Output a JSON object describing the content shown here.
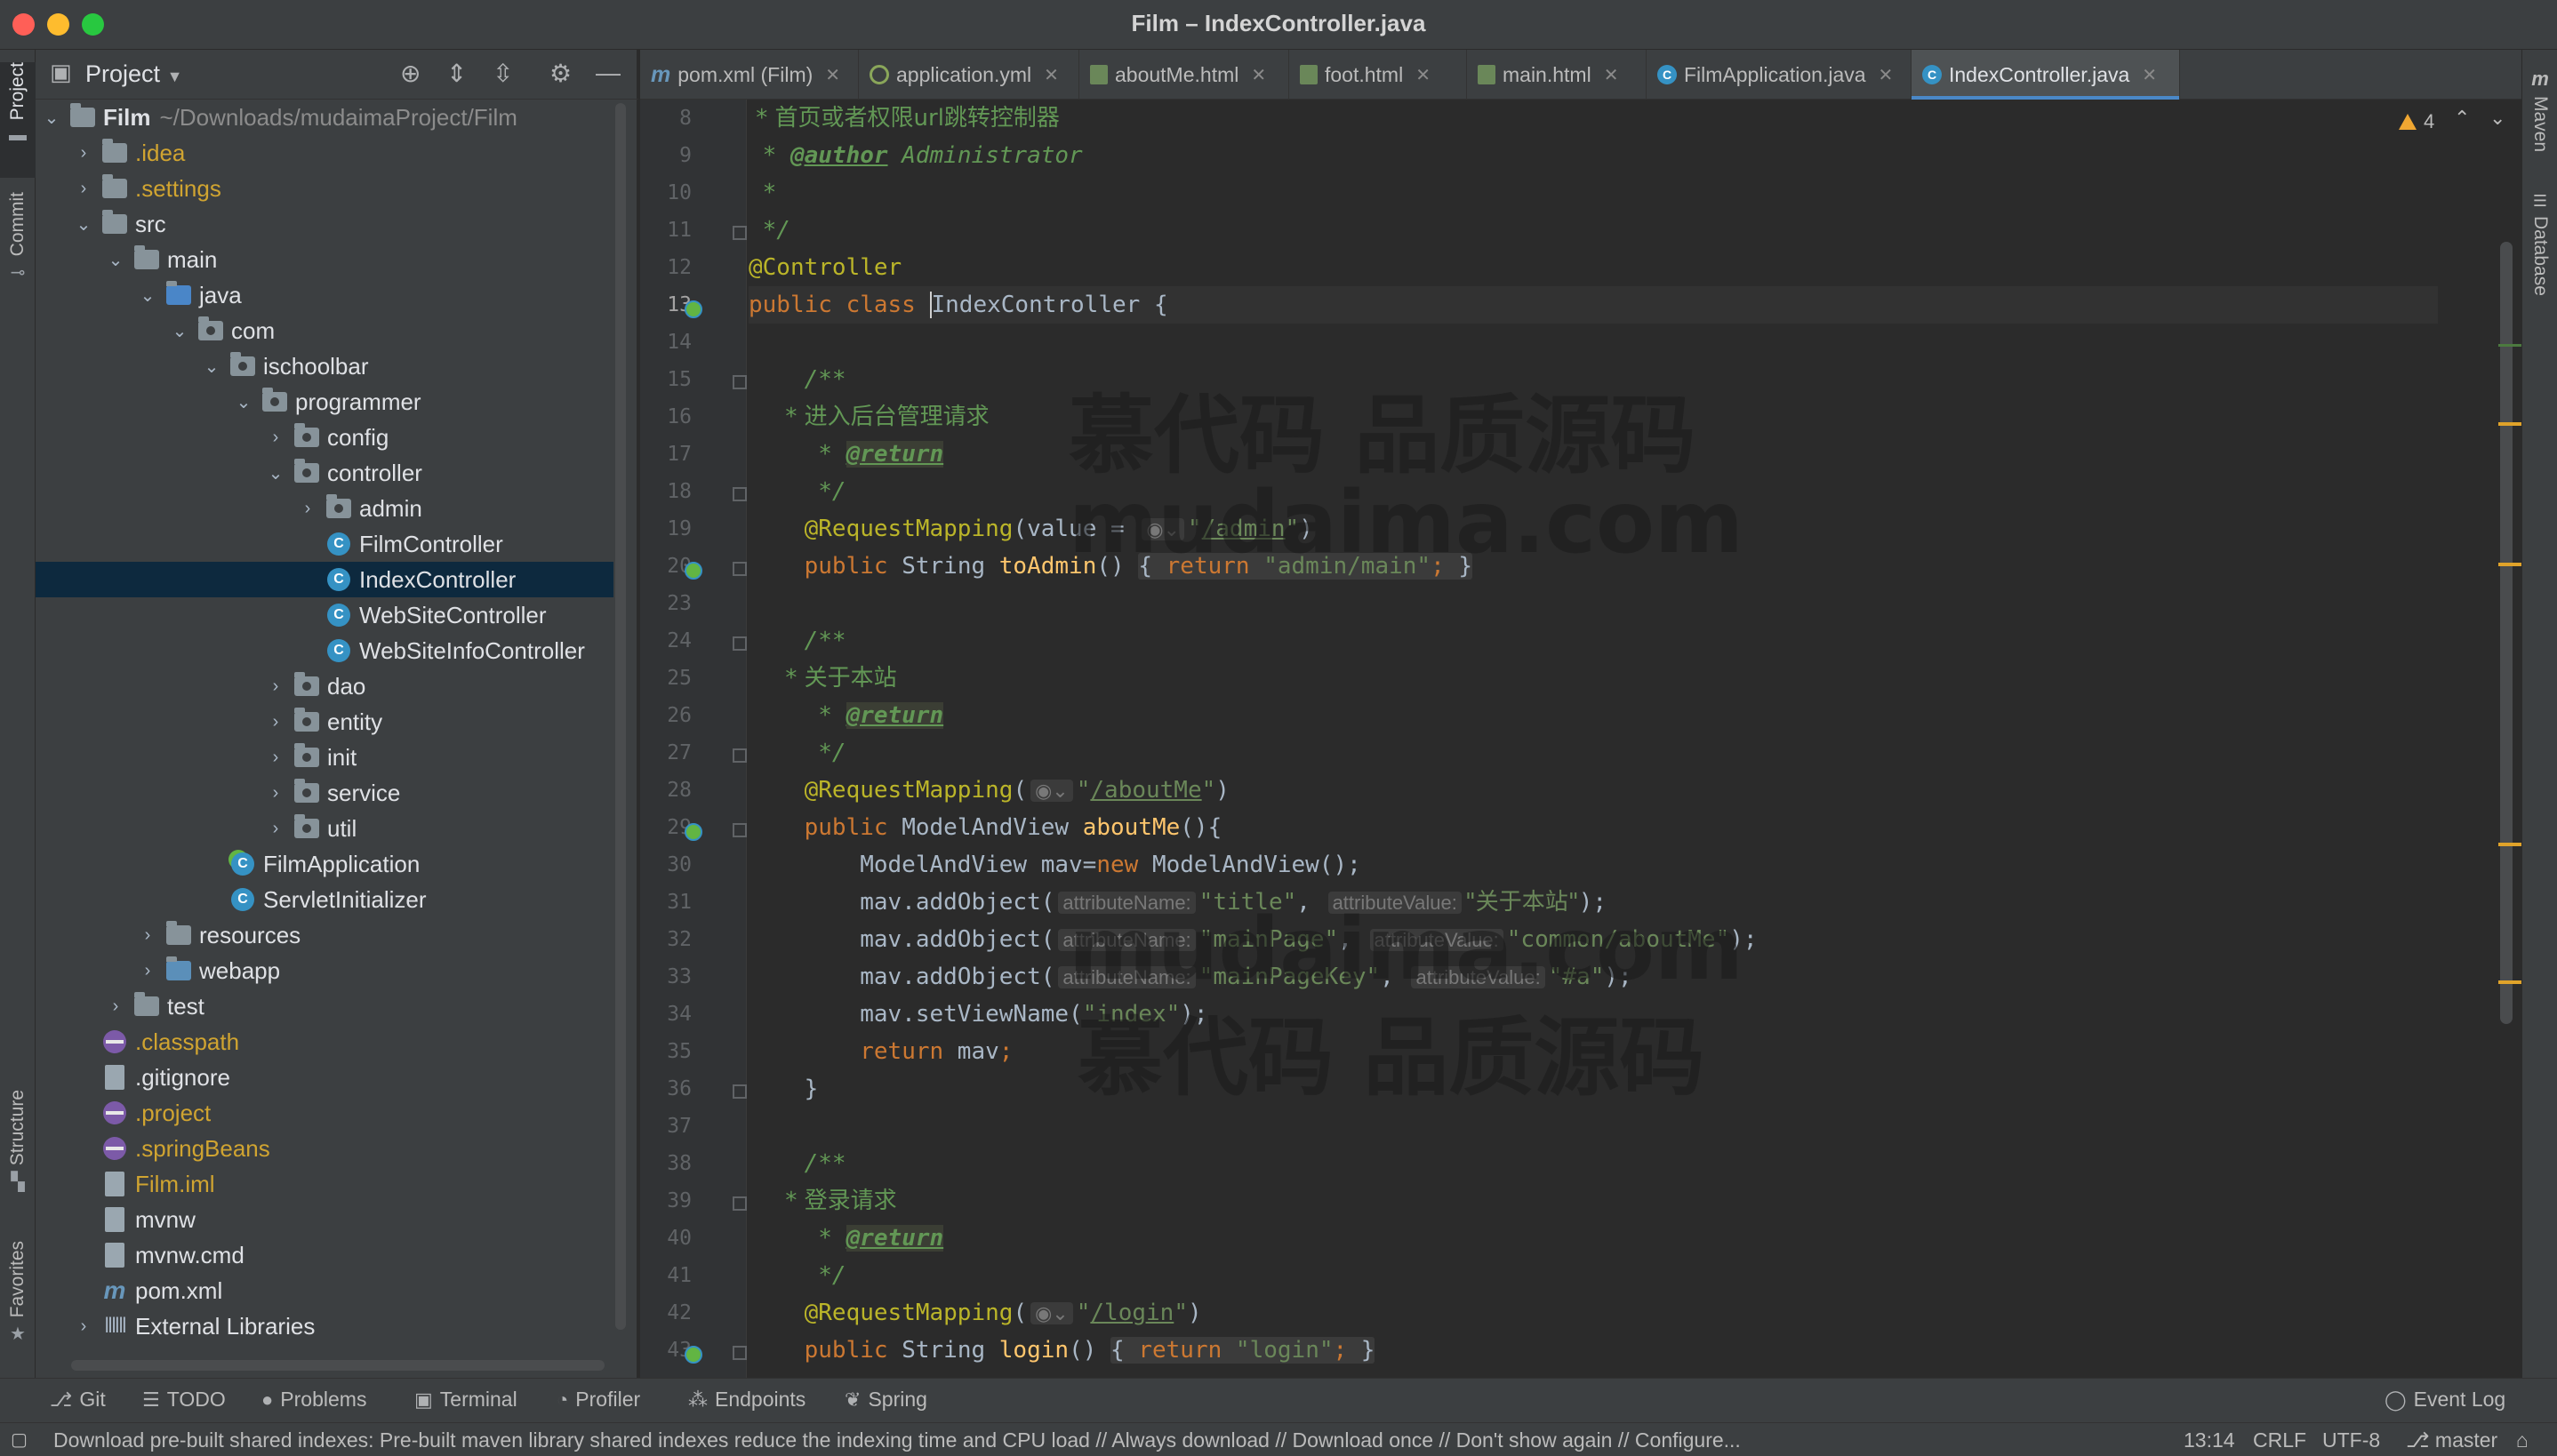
{
  "window": {
    "title": "Film – IndexController.java"
  },
  "left_strip": {
    "project": "Project",
    "commit": "Commit",
    "structure": "Structure",
    "favorites": "Favorites"
  },
  "right_strip": {
    "maven": "Maven",
    "database": "Database"
  },
  "project_panel": {
    "title": "Project",
    "tree": [
      {
        "label": "Film",
        "extra": "~/Downloads/mudaimaProject/Film"
      },
      {
        "label": ".idea"
      },
      {
        "label": ".settings"
      },
      {
        "label": "src"
      },
      {
        "label": "main"
      },
      {
        "label": "java"
      },
      {
        "label": "com"
      },
      {
        "label": "ischoolbar"
      },
      {
        "label": "programmer"
      },
      {
        "label": "config"
      },
      {
        "label": "controller"
      },
      {
        "label": "admin"
      },
      {
        "label": "FilmController"
      },
      {
        "label": "IndexController"
      },
      {
        "label": "WebSiteController"
      },
      {
        "label": "WebSiteInfoController"
      },
      {
        "label": "dao"
      },
      {
        "label": "entity"
      },
      {
        "label": "init"
      },
      {
        "label": "service"
      },
      {
        "label": "util"
      },
      {
        "label": "FilmApplication"
      },
      {
        "label": "ServletInitializer"
      },
      {
        "label": "resources"
      },
      {
        "label": "webapp"
      },
      {
        "label": "test"
      },
      {
        "label": ".classpath"
      },
      {
        "label": ".gitignore"
      },
      {
        "label": ".project"
      },
      {
        "label": ".springBeans"
      },
      {
        "label": "Film.iml"
      },
      {
        "label": "mvnw"
      },
      {
        "label": "mvnw.cmd"
      },
      {
        "label": "pom.xml"
      },
      {
        "label": "External Libraries"
      }
    ]
  },
  "tabs": [
    {
      "label": "pom.xml (Film)"
    },
    {
      "label": "application.yml"
    },
    {
      "label": "aboutMe.html"
    },
    {
      "label": "foot.html"
    },
    {
      "label": "main.html"
    },
    {
      "label": "FilmApplication.java"
    },
    {
      "label": "IndexController.java"
    }
  ],
  "editor": {
    "warnings_count": "4",
    "line_numbers": [
      "8",
      "9",
      "10",
      "11",
      "12",
      "13",
      "14",
      "15",
      "16",
      "17",
      "18",
      "19",
      "20",
      "23",
      "24",
      "25",
      "26",
      "27",
      "28",
      "29",
      "30",
      "31",
      "32",
      "33",
      "34",
      "35",
      "36",
      "37",
      "38",
      "39",
      "40",
      "41",
      "42",
      "43"
    ],
    "code": {
      "l8": " * 首页或者权限url跳转控制器",
      "l9_tag": "@author",
      "l9_text": " Administrator",
      "l10": " *",
      "l11": " */",
      "l12": "@Controller",
      "l13_kw": "public class ",
      "l13_name": "IndexController",
      "l13_rest": " {",
      "l15": "    /**",
      "l16": "     * 进入后台管理请求",
      "l17_tag": "@return",
      "l18": "     */",
      "l19_ann": "@RequestMapping",
      "l19_a": "(value = ",
      "l19_url": "/admin",
      "l20_sig": "toAdmin",
      "l20_str": "\"admin/main\"",
      "l24": "    /**",
      "l25": "     * 关于本站",
      "l26_tag": "@return",
      "l27": "     */",
      "l28_url": "/aboutMe",
      "l29_type": "ModelAndView ",
      "l29_fn": "aboutMe",
      "l30": "        ModelAndView mav=",
      "l30_new": "new",
      "l30_rest": " ModelAndView();",
      "l31_s1": "\"title\"",
      "l31_s2": "\"关于本站\"",
      "l32_s1": "\"mainPage\"",
      "l32_s2": "\"common/aboutMe\"",
      "l33_s1": "\"mainPageKey\"",
      "l33_s2": "\"#a\"",
      "l34_s": "\"index\"",
      "l35": "return",
      "l36": "    }",
      "l38": "    /**",
      "l39": "     * 登录请求",
      "l40_tag": "@return",
      "l41": "     */",
      "l42_url": "/login",
      "l43_fn": "login",
      "l43_str": "\"login\"",
      "hint_name": "attributeName:",
      "hint_value": "attributeValue:"
    },
    "watermark": {
      "cn": "慕代码 品质源码",
      "url": "mudaima.com"
    }
  },
  "bottom_tools": [
    "Git",
    "TODO",
    "Problems",
    "Terminal",
    "Profiler",
    "Endpoints",
    "Spring",
    "Event Log"
  ],
  "status": {
    "message": "Download pre-built shared indexes: Pre-built maven library shared indexes reduce the indexing time and CPU load // Always download // Download once // Don't show again // Configure...",
    "position": "13:14",
    "line_sep": "CRLF",
    "encoding": "UTF-8",
    "branch": "master"
  }
}
